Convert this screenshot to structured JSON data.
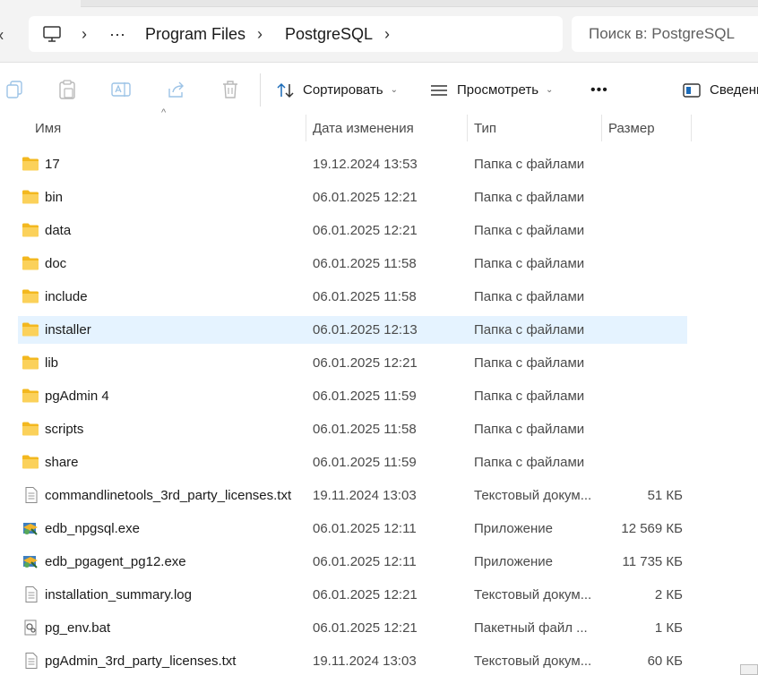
{
  "address_bar": {
    "breadcrumbs": [
      {
        "label": "Program Files"
      },
      {
        "label": "PostgreSQL"
      }
    ],
    "overflow_label": "···",
    "search_placeholder": "Поиск в: PostgreSQL"
  },
  "toolbar": {
    "sort_label": "Сортировать",
    "view_label": "Просмотреть",
    "more_label": "•••",
    "details_label": "Сведения"
  },
  "columns": {
    "name": "Имя",
    "date": "Дата изменения",
    "type": "Тип",
    "size": "Размер"
  },
  "files": [
    {
      "name": "17",
      "date": "19.12.2024 13:53",
      "type": "Папка с файлами",
      "size": "",
      "icon": "folder-icon"
    },
    {
      "name": "bin",
      "date": "06.01.2025 12:21",
      "type": "Папка с файлами",
      "size": "",
      "icon": "folder-icon"
    },
    {
      "name": "data",
      "date": "06.01.2025 12:21",
      "type": "Папка с файлами",
      "size": "",
      "icon": "folder-icon"
    },
    {
      "name": "doc",
      "date": "06.01.2025 11:58",
      "type": "Папка с файлами",
      "size": "",
      "icon": "folder-icon"
    },
    {
      "name": "include",
      "date": "06.01.2025 11:58",
      "type": "Папка с файлами",
      "size": "",
      "icon": "folder-icon"
    },
    {
      "name": "installer",
      "date": "06.01.2025 12:13",
      "type": "Папка с файлами",
      "size": "",
      "icon": "folder-icon",
      "selected": true
    },
    {
      "name": "lib",
      "date": "06.01.2025 12:21",
      "type": "Папка с файлами",
      "size": "",
      "icon": "folder-icon"
    },
    {
      "name": "pgAdmin 4",
      "date": "06.01.2025 11:59",
      "type": "Папка с файлами",
      "size": "",
      "icon": "folder-icon"
    },
    {
      "name": "scripts",
      "date": "06.01.2025 11:58",
      "type": "Папка с файлами",
      "size": "",
      "icon": "folder-icon"
    },
    {
      "name": "share",
      "date": "06.01.2025 11:59",
      "type": "Папка с файлами",
      "size": "",
      "icon": "folder-icon"
    },
    {
      "name": "commandlinetools_3rd_party_licenses.txt",
      "date": "19.11.2024 13:03",
      "type": "Текстовый докум...",
      "size": "51 КБ",
      "icon": "text-file-icon"
    },
    {
      "name": "edb_npgsql.exe",
      "date": "06.01.2025 12:11",
      "type": "Приложение",
      "size": "12 569 КБ",
      "icon": "installer-exe-icon"
    },
    {
      "name": "edb_pgagent_pg12.exe",
      "date": "06.01.2025 12:11",
      "type": "Приложение",
      "size": "11 735 КБ",
      "icon": "installer-exe-icon"
    },
    {
      "name": "installation_summary.log",
      "date": "06.01.2025 12:21",
      "type": "Текстовый докум...",
      "size": "2 КБ",
      "icon": "text-file-icon"
    },
    {
      "name": "pg_env.bat",
      "date": "06.01.2025 12:21",
      "type": "Пакетный файл ...",
      "size": "1 КБ",
      "icon": "batch-file-icon"
    },
    {
      "name": "pgAdmin_3rd_party_licenses.txt",
      "date": "19.11.2024 13:03",
      "type": "Текстовый докум...",
      "size": "60 КБ",
      "icon": "text-file-icon"
    }
  ],
  "colors": {
    "folder": "#f5c02e",
    "selection": "#e5f3ff",
    "accent": "#0067c0"
  }
}
